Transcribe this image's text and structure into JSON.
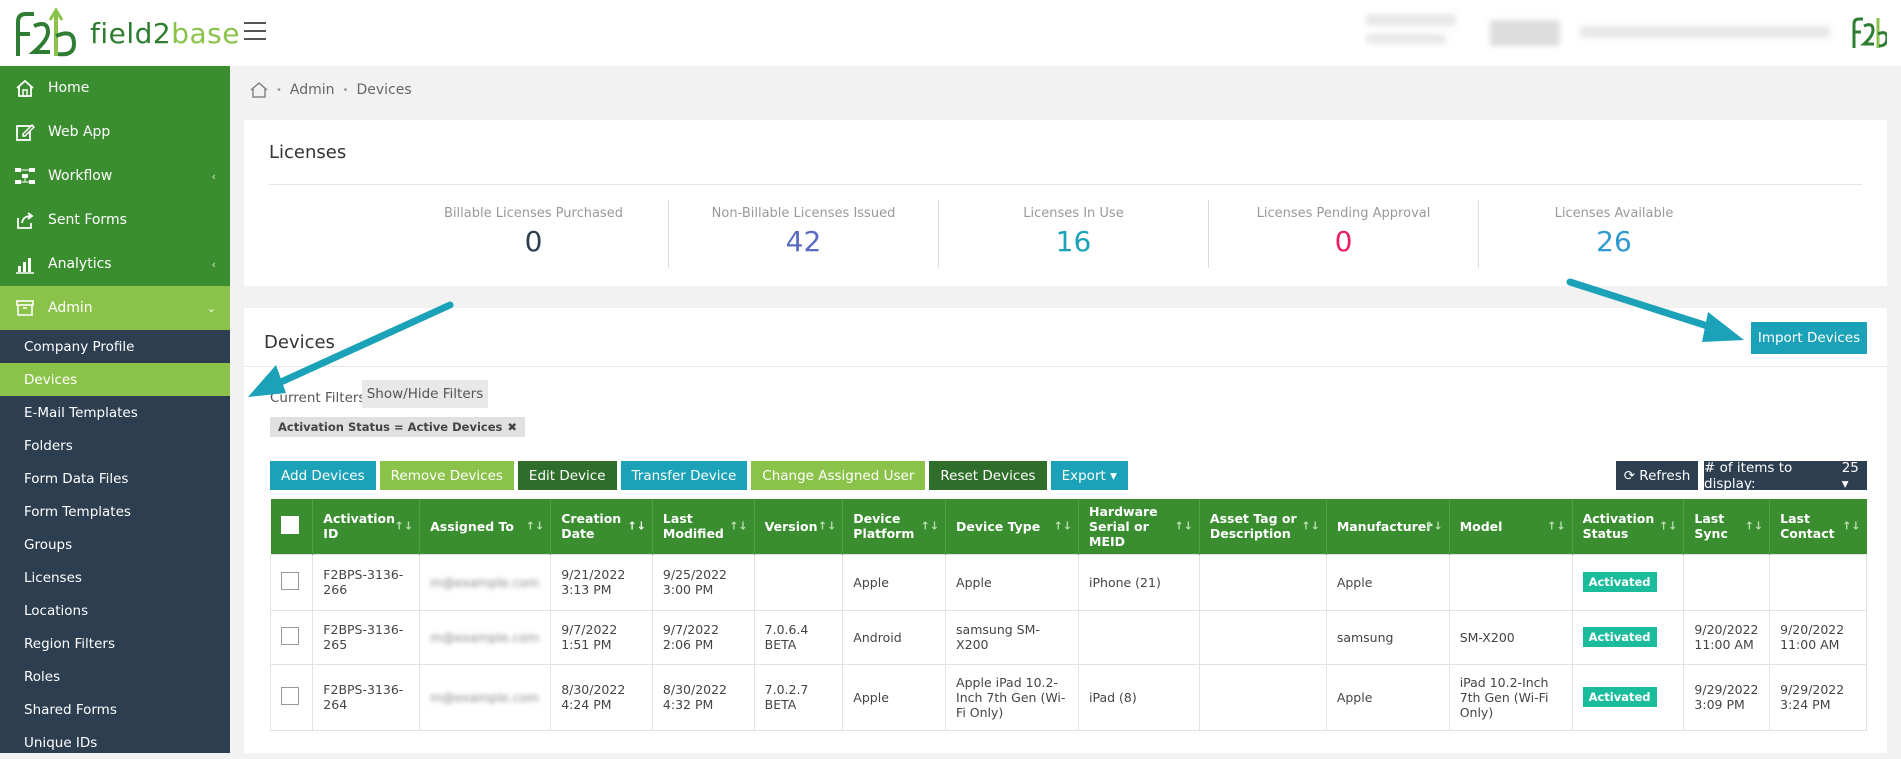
{
  "brand": {
    "name_part1": "field2",
    "name_part2": "base",
    "green": "#3a8e2f",
    "lightgreen": "#8bc34a",
    "teal": "#1ba2b8"
  },
  "sidebar": {
    "main_items": [
      {
        "label": "Home",
        "icon": "home-icon"
      },
      {
        "label": "Web App",
        "icon": "edit-icon"
      },
      {
        "label": "Workflow",
        "icon": "workflow-icon",
        "chevron": "‹"
      },
      {
        "label": "Sent Forms",
        "icon": "share-icon"
      },
      {
        "label": "Analytics",
        "icon": "chart-icon",
        "chevron": "‹"
      },
      {
        "label": "Admin",
        "icon": "archive-icon",
        "chevron": "⌄"
      }
    ],
    "sub_items": [
      "Company Profile",
      "Devices",
      "E-Mail Templates",
      "Folders",
      "Form Data Files",
      "Form Templates",
      "Groups",
      "Licenses",
      "Locations",
      "Region Filters",
      "Roles",
      "Shared Forms",
      "Unique IDs"
    ]
  },
  "breadcrumb": {
    "items": [
      "Admin",
      "Devices"
    ],
    "separator": "•"
  },
  "licenses": {
    "title": "Licenses",
    "stats": [
      {
        "label": "Billable Licenses Purchased",
        "value": "0",
        "color": "#2c3e50"
      },
      {
        "label": "Non-Billable Licenses Issued",
        "value": "42",
        "color": "#5c6bc0"
      },
      {
        "label": "Licenses In Use",
        "value": "16",
        "color": "#1ba2b8"
      },
      {
        "label": "Licenses Pending Approval",
        "value": "0",
        "color": "#e91e63"
      },
      {
        "label": "Licenses Available",
        "value": "26",
        "color": "#2e9ad0"
      }
    ]
  },
  "devices": {
    "title": "Devices",
    "import_label": "Import Devices",
    "filters_label": "Current Filters:",
    "show_hide_label": "Show/Hide Filters",
    "filter_tag": "Activation Status = Active Devices",
    "filter_tag_close": "✖",
    "actions": [
      "Add Devices",
      "Remove Devices",
      "Edit Device",
      "Transfer Device",
      "Change Assigned User",
      "Reset Devices",
      "Export ▾"
    ],
    "refresh_label": "⟳ Refresh",
    "items_label": "# of items to display:",
    "items_value": "25 ▾",
    "columns": [
      "Activation ID",
      "Assigned To",
      "Creation Date",
      "Last Modified",
      "Version",
      "Device Platform",
      "Device Type",
      "Hardware Serial or MEID",
      "Asset Tag or Description",
      "Manufacturer",
      "Model",
      "Activation Status",
      "Last Sync",
      "Last Contact"
    ],
    "sort_glyph": "↑↓",
    "sort_active_glyph": "↑↓",
    "rows": [
      {
        "id": "F2BPS-3136-266",
        "assigned": "m@example.com",
        "created": "9/21/2022 3:13 PM",
        "modified": "9/25/2022 3:00 PM",
        "version": "",
        "platform": "Apple",
        "type": "Apple",
        "serial": "iPhone (21)",
        "asset": "",
        "manufacturer": "Apple",
        "model": "",
        "status": "Activated",
        "sync": "",
        "contact": ""
      },
      {
        "id": "F2BPS-3136-265",
        "assigned": "m@example.com",
        "created": "9/7/2022 1:51 PM",
        "modified": "9/7/2022 2:06 PM",
        "version": "7.0.6.4 BETA",
        "platform": "Android",
        "type": "samsung SM-X200",
        "serial": "",
        "asset": "",
        "manufacturer": "samsung",
        "model": "SM-X200",
        "status": "Activated",
        "sync": "9/20/2022 11:00 AM",
        "contact": "9/20/2022 11:00 AM"
      },
      {
        "id": "F2BPS-3136-264",
        "assigned": "m@example.com",
        "created": "8/30/2022 4:24 PM",
        "modified": "8/30/2022 4:32 PM",
        "version": "7.0.2.7 BETA",
        "platform": "Apple",
        "type": "Apple iPad 10.2-Inch 7th Gen (Wi-Fi Only)",
        "serial": "iPad (8)",
        "asset": "",
        "manufacturer": "Apple",
        "model": "iPad 10.2-Inch 7th Gen (Wi-Fi Only)",
        "status": "Activated",
        "sync": "9/29/2022 3:09 PM",
        "contact": "9/29/2022 3:24 PM"
      }
    ]
  }
}
